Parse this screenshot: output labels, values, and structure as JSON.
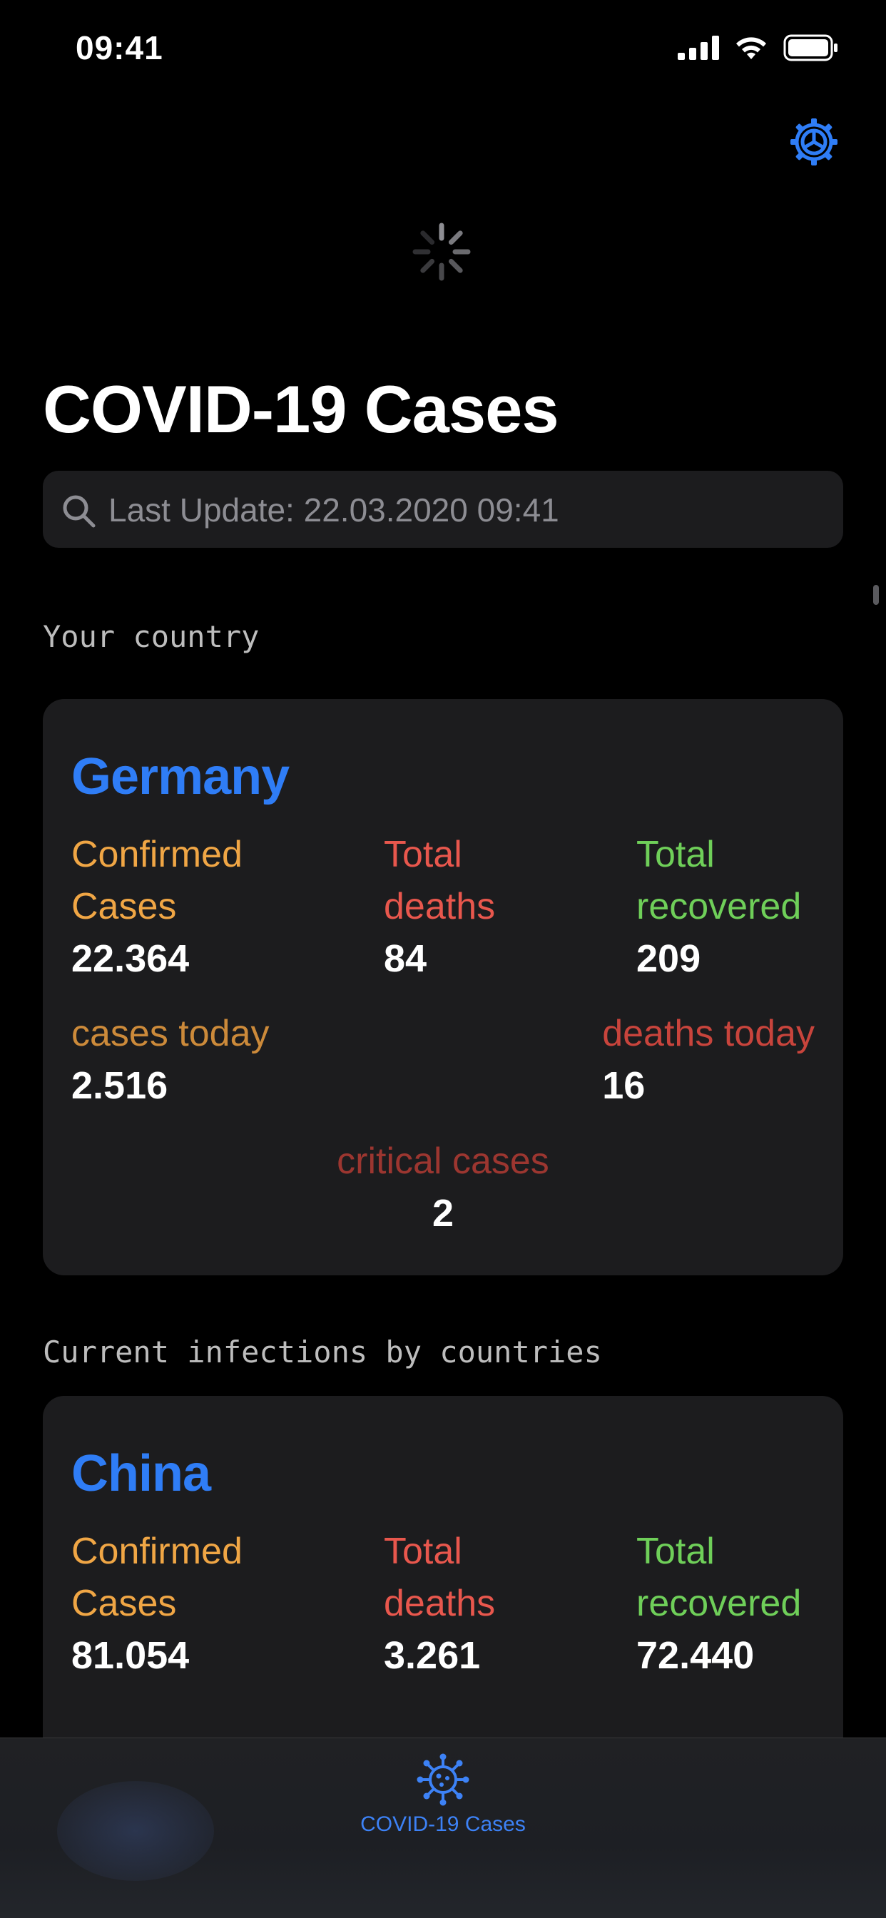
{
  "status_bar": {
    "time": "09:41"
  },
  "nav": {
    "settings_icon": "gear-icon",
    "loading_icon": "activity-spinner"
  },
  "title": "COVID-19 Cases",
  "search": {
    "placeholder": "Last Update: 22.03.2020 09:41",
    "icon": "search-icon"
  },
  "sections": {
    "your_country": "Your country",
    "by_countries": "Current infections by countries"
  },
  "germany": {
    "name": "Germany",
    "confirmed_label_1": "Confirmed",
    "confirmed_label_2": "Cases",
    "confirmed": "22.364",
    "deaths_label_1": "Total",
    "deaths_label_2": "deaths",
    "deaths": "84",
    "recovered_label_1": "Total",
    "recovered_label_2": "recovered",
    "recovered": "209",
    "cases_today_label": "cases today",
    "cases_today": "2.516",
    "deaths_today_label": "deaths today",
    "deaths_today": "16",
    "critical_label": "critical cases",
    "critical": "2"
  },
  "china": {
    "name": "China",
    "confirmed_label_1": "Confirmed",
    "confirmed_label_2": "Cases",
    "confirmed": "81.054",
    "deaths_label_1": "Total",
    "deaths_label_2": "deaths",
    "deaths": "3.261",
    "recovered_label_1": "Total",
    "recovered_label_2": "recovered",
    "recovered": "72.440"
  },
  "tab_bar": {
    "items": [
      {
        "label": "COVID-19 Cases",
        "icon": "virus-icon",
        "selected": true
      }
    ]
  },
  "colors": {
    "accent": "#2f7df6",
    "confirmed": "#f0a645",
    "deaths": "#e8574d",
    "recovered": "#6fcf59",
    "background": "#000000",
    "card": "#1c1c1e"
  }
}
